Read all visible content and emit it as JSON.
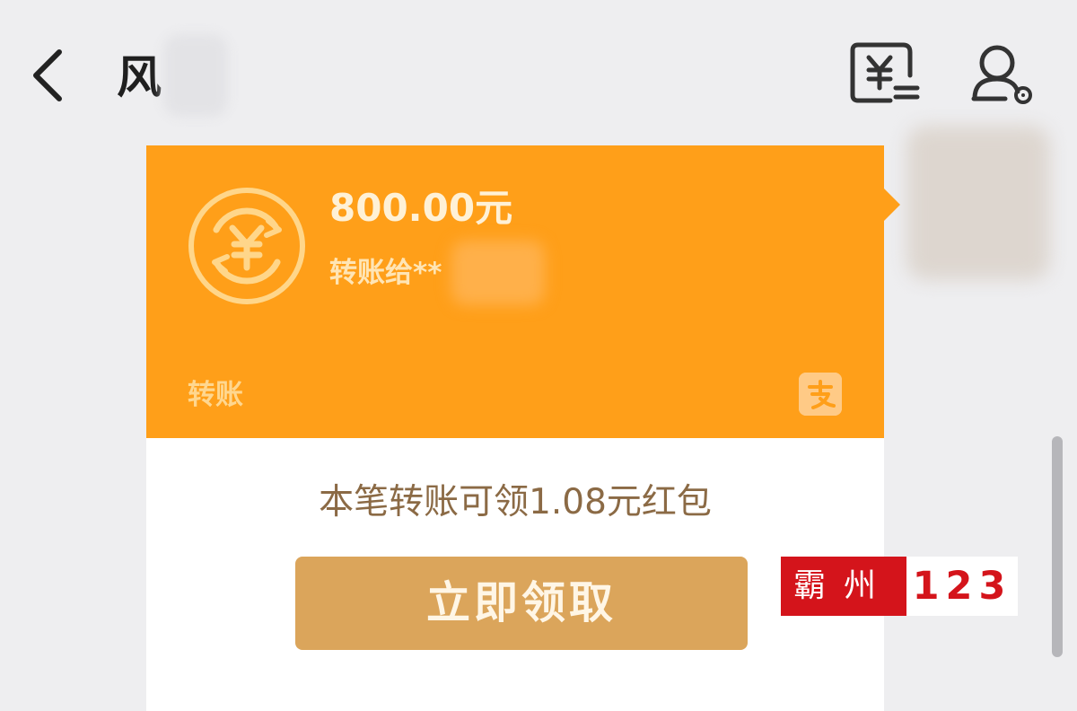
{
  "header": {
    "title": "风",
    "icons": {
      "back": "chevron-left-icon",
      "transfer": "transfer-yuan-icon",
      "profile": "profile-settings-icon"
    }
  },
  "transfer_card": {
    "amount": "800.00元",
    "recipient_prefix": "转账给",
    "recipient_suffix": "**",
    "footer_label": "转账",
    "icon": "transfer-circle-icon",
    "brand_icon": "alipay-icon",
    "hongbao_text": "本笔转账可领1.08元红包",
    "claim_button": "立即领取"
  },
  "watermark": {
    "red_text": "霸州",
    "number_text": "123"
  },
  "colors": {
    "orange": "#ff9f19",
    "button": "#dba55b",
    "watermark_red": "#d4141b"
  }
}
